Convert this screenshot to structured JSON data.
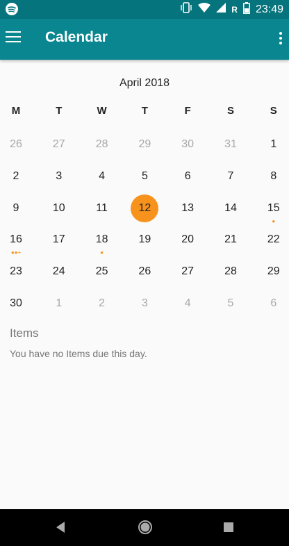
{
  "status_bar": {
    "time": "23:49",
    "network_letter": "R",
    "icons": [
      "spotify-icon",
      "vibrate-icon",
      "wifi-icon",
      "signal-icon",
      "battery-icon"
    ]
  },
  "app_bar": {
    "title": "Calendar",
    "icons": [
      "menu-icon",
      "overflow-menu-icon"
    ]
  },
  "calendar": {
    "month_label": "April 2018",
    "weekdays": [
      "M",
      "T",
      "W",
      "T",
      "F",
      "S",
      "S"
    ],
    "weeks": [
      [
        {
          "day": "26",
          "current": false
        },
        {
          "day": "27",
          "current": false
        },
        {
          "day": "28",
          "current": false
        },
        {
          "day": "29",
          "current": false
        },
        {
          "day": "30",
          "current": false
        },
        {
          "day": "31",
          "current": false
        },
        {
          "day": "1",
          "current": true
        }
      ],
      [
        {
          "day": "2",
          "current": true
        },
        {
          "day": "3",
          "current": true
        },
        {
          "day": "4",
          "current": true
        },
        {
          "day": "5",
          "current": true
        },
        {
          "day": "6",
          "current": true
        },
        {
          "day": "7",
          "current": true
        },
        {
          "day": "8",
          "current": true
        }
      ],
      [
        {
          "day": "9",
          "current": true
        },
        {
          "day": "10",
          "current": true
        },
        {
          "day": "11",
          "current": true
        },
        {
          "day": "12",
          "current": true,
          "selected": true
        },
        {
          "day": "13",
          "current": true
        },
        {
          "day": "14",
          "current": true
        },
        {
          "day": "15",
          "current": true,
          "markers": "●"
        }
      ],
      [
        {
          "day": "16",
          "current": true,
          "markers": "●●+"
        },
        {
          "day": "17",
          "current": true
        },
        {
          "day": "18",
          "current": true,
          "markers": "●"
        },
        {
          "day": "19",
          "current": true
        },
        {
          "day": "20",
          "current": true
        },
        {
          "day": "21",
          "current": true
        },
        {
          "day": "22",
          "current": true
        }
      ],
      [
        {
          "day": "23",
          "current": true
        },
        {
          "day": "24",
          "current": true
        },
        {
          "day": "25",
          "current": true
        },
        {
          "day": "26",
          "current": true
        },
        {
          "day": "27",
          "current": true
        },
        {
          "day": "28",
          "current": true
        },
        {
          "day": "29",
          "current": true
        }
      ],
      [
        {
          "day": "30",
          "current": true
        },
        {
          "day": "1",
          "current": false
        },
        {
          "day": "2",
          "current": false
        },
        {
          "day": "3",
          "current": false
        },
        {
          "day": "4",
          "current": false
        },
        {
          "day": "5",
          "current": false
        },
        {
          "day": "6",
          "current": false
        }
      ]
    ]
  },
  "items": {
    "heading": "Items",
    "empty_message": "You have no Items due this day."
  },
  "nav_bar": {
    "icons": [
      "back-icon",
      "home-icon",
      "recents-icon"
    ]
  },
  "colors": {
    "status_bar": "#06747c",
    "app_bar": "#0a8690",
    "accent": "#f7921c",
    "muted_text": "#a8a8a8",
    "background": "#fafafa"
  }
}
